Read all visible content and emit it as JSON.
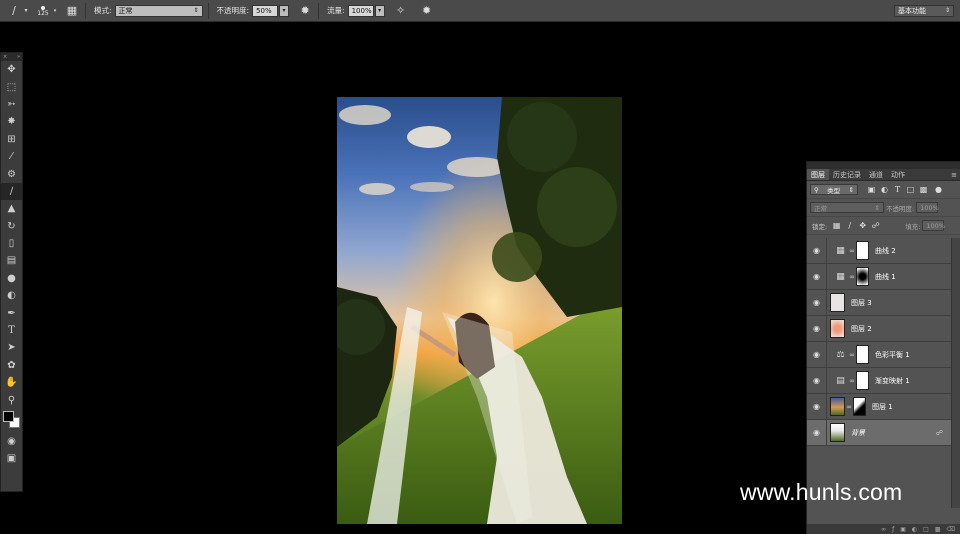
{
  "options_bar": {
    "brush_size": "125",
    "mode_label": "模式:",
    "mode_value": "正常",
    "opacity_label": "不透明度:",
    "opacity_value": "50%",
    "flow_label": "流量:",
    "flow_value": "100%",
    "workspace": "基本功能"
  },
  "layers_panel": {
    "tabs": [
      "图层",
      "历史记录",
      "通道",
      "动作"
    ],
    "filter_kind": "类型",
    "blend_mode": "正常",
    "opacity_label": "不透明度:",
    "opacity_value": "100%",
    "lock_label": "锁定:",
    "fill_label": "填充:",
    "fill_value": "100%",
    "layers": [
      {
        "name": "曲线 2",
        "type": "adjustment",
        "icon": "curves-icon"
      },
      {
        "name": "曲线 1",
        "type": "adjustment",
        "icon": "curves-icon"
      },
      {
        "name": "图层 3",
        "type": "pixel"
      },
      {
        "name": "图层 2",
        "type": "pixel"
      },
      {
        "name": "色彩平衡 1",
        "type": "adjustment",
        "icon": "balance-icon"
      },
      {
        "name": "渐变映射 1",
        "type": "adjustment",
        "icon": "gradient-map-icon"
      },
      {
        "name": "图层 1",
        "type": "pixel-masked"
      },
      {
        "name": "背景",
        "type": "background",
        "locked": true
      }
    ]
  },
  "watermark": "www.hunls.com",
  "colors": {
    "ui_bg": "#535353",
    "options_bg": "#4a4a4a",
    "canvas_bg": "#000000",
    "selected_layer": "#6c6c6c"
  }
}
